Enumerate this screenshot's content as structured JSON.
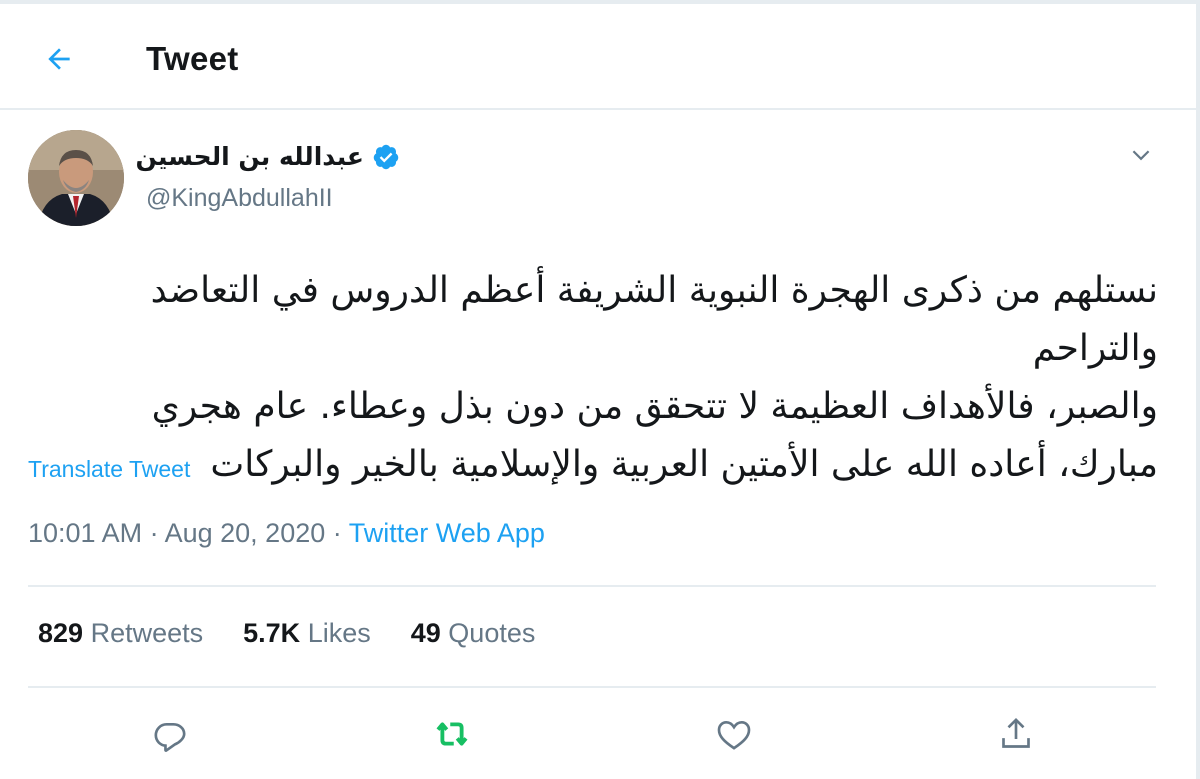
{
  "header": {
    "title": "Tweet",
    "back_icon": "arrow-left-icon"
  },
  "author": {
    "display_name": "عبدالله بن الحسين",
    "handle": "@KingAbdullahII",
    "verified": true
  },
  "tweet": {
    "lines": [
      "نستلهم من ذكرى الهجرة النبوية الشريفة أعظم الدروس في التعاضد والتراحم",
      "والصبر، فالأهداف العظيمة لا تتحقق من دون بذل وعطاء. عام هجري",
      "مبارك، أعاده الله على الأمتين العربية والإسلامية بالخير والبركات"
    ],
    "translate_label": "Translate Tweet",
    "time": "10:01 AM",
    "sep1": " · ",
    "date": "Aug 20, 2020",
    "sep2": " · ",
    "source": "Twitter Web App"
  },
  "stats": [
    {
      "count": "829",
      "label": "Retweets"
    },
    {
      "count": "5.7K",
      "label": "Likes"
    },
    {
      "count": "49",
      "label": "Quotes"
    }
  ],
  "actions": [
    "reply-icon",
    "retweet-icon",
    "like-icon",
    "share-icon"
  ],
  "colors": {
    "accent": "#1da1f2",
    "retweet_green": "#17bf63",
    "muted": "#657786",
    "text": "#14171a",
    "border": "#e6ecf0"
  }
}
